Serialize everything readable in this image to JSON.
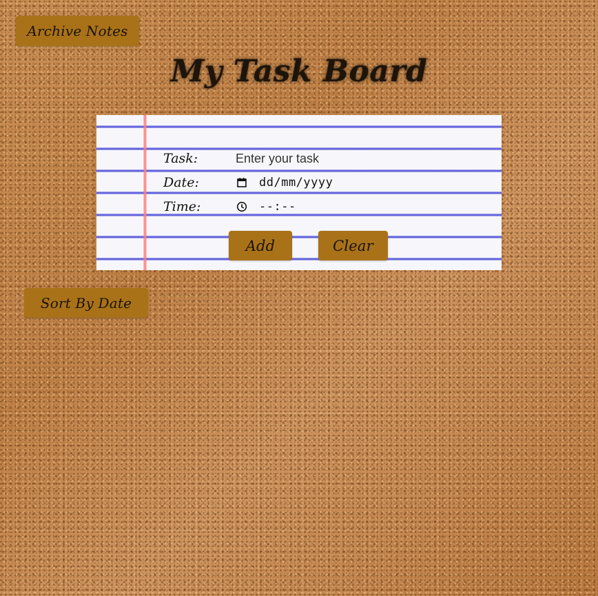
{
  "toolbar": {
    "archive_label": "Archive Notes",
    "sort_label": "Sort By Date"
  },
  "header": {
    "title": "My Task Board"
  },
  "form": {
    "task": {
      "label": "Task:",
      "placeholder": "Enter your task",
      "value": ""
    },
    "date": {
      "label": "Date:",
      "icon": "calendar-icon",
      "display": "dd/mm/yyyy"
    },
    "time": {
      "label": "Time:",
      "icon": "clock-icon",
      "display": "--:--"
    },
    "add_label": "Add",
    "clear_label": "Clear"
  },
  "colors": {
    "button": "#a97219",
    "paper": "#f7f7fb",
    "rule_line": "#4a4ad6",
    "margin_line": "#ff7d7d"
  }
}
